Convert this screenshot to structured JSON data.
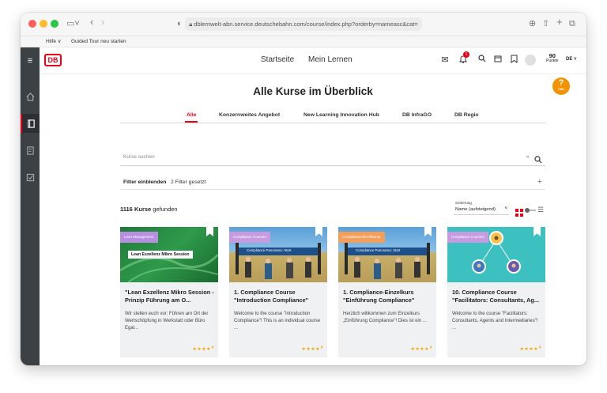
{
  "browser": {
    "url": "dblernwelt-abn.service.deutschebahn.com/course/index.php?orderby=nameasc&cat=",
    "bookmarks": [
      "Hilfe ∨",
      "Guided Tour neu starten"
    ]
  },
  "header": {
    "logo": "DB",
    "nav": [
      "Startseite",
      "Mein Lernen"
    ],
    "notification_count": "1",
    "points_value": "90",
    "points_label": "Punkte",
    "language": "DE"
  },
  "help_button": {
    "symbol": "?",
    "label": "Hilfe"
  },
  "page": {
    "title": "Alle Kurse im Überblick",
    "tabs": [
      "Alle",
      "Konzernweites Angebot",
      "New Learning Innovation Hub",
      "DB InfraGO",
      "DB Regio"
    ],
    "search_placeholder": "Kurse suchen",
    "filter_label": "Filter einblenden",
    "filter_count": "2 Filter gesetzt",
    "result_count": "1116 Kurse",
    "result_suffix": "gefunden",
    "sort_label": "Sortierung",
    "sort_value": "Name (aufsteigend)"
  },
  "colors": {
    "accent": "#ec0016",
    "help": "#f39200",
    "star": "#f0a800"
  },
  "cards": [
    {
      "tag": "Lean Management",
      "tag_color": "#b78ee0",
      "image_text": "Lean Exzellenz Mikro Session",
      "title": "\"Lean Exzellenz Mikro Session - Prinzip Führung am O...",
      "desc": "Wir stellen euch vor: Führen am Ort der Wertschöpfung in Werkstatt oder Büro Egal...",
      "rating": 4.5
    },
    {
      "tag": "Compliance Courses",
      "tag_color": "#c79be0",
      "image_text": "Compliance Panorama: Start",
      "title": "1. Compliance Course \"Introduction Compliance\"",
      "desc": "Welcome to the course \"Introduction Compliance\"! This is an individual course ...",
      "rating": 4.5
    },
    {
      "tag": "Compliance-Einzelkurse",
      "tag_color": "#f39e5a",
      "image_text": "Compliance Panorama: Start",
      "title": "1. Compliance-Einzelkurs \"Einführung Compliance\"",
      "desc": "Herzlich willkommen zum Einzelkurs „Einführung Compliance\"! Dies ist ein ...",
      "rating": 4.5
    },
    {
      "tag": "Compliance Courses",
      "tag_color": "#c79be0",
      "image_text": "",
      "title": "10. Compliance Course \"Facilitators: Consultants, Ag...",
      "desc": "Welcome to the course \"Facilitators: Consultants, Agents and Intermediaries\"! ...",
      "rating": 4.5
    }
  ]
}
